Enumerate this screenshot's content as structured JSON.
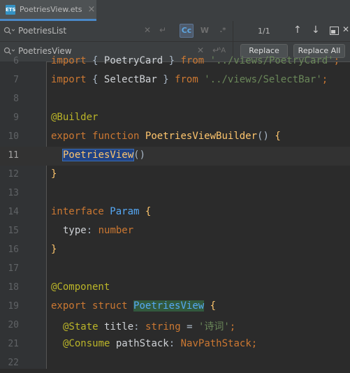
{
  "tab": {
    "file_name": "PoetriesView.ets",
    "icon_label": "ETS",
    "close": "×"
  },
  "find": {
    "query": "PoetriesList",
    "count": "1/1"
  },
  "replace": {
    "value": "PoetriesView",
    "replace_label": "Replace",
    "replace_all_label": "Replace All"
  },
  "find_options": {
    "case": "Cc",
    "words": "W",
    "regex": ".*"
  },
  "editor": {
    "lines": [
      {
        "n": "6"
      },
      {
        "n": "7"
      },
      {
        "n": "8"
      },
      {
        "n": "9"
      },
      {
        "n": "10"
      },
      {
        "n": "11"
      },
      {
        "n": "12"
      },
      {
        "n": "13"
      },
      {
        "n": "14"
      },
      {
        "n": "15"
      },
      {
        "n": "16"
      },
      {
        "n": "17"
      },
      {
        "n": "18"
      },
      {
        "n": "19"
      },
      {
        "n": "20"
      },
      {
        "n": "21"
      },
      {
        "n": "22"
      }
    ],
    "t": {
      "import": "import",
      "lb": "{",
      "rb": "}",
      "poetrycard": "PoetryCard",
      "from": "from",
      "path_card": "'../views/PoetryCard'",
      "semi": ";",
      "selectbar": "SelectBar",
      "path_select": "'../views/SelectBar'",
      "builder": "@Builder",
      "export": "export",
      "function": "function",
      "builder_fn": "PoetriesViewBuilder",
      "parens": "()",
      "open_brace": "{",
      "call_name": "PoetriesView",
      "close_brace": "}",
      "interface": "interface",
      "param": "Param",
      "type_key": "type",
      "colon": ":",
      "number": "number",
      "component": "@Component",
      "struct": "struct",
      "struct_name": "PoetriesView",
      "state": "@State",
      "title": "title",
      "string": "string",
      "eq": "=",
      "title_val": "'诗词'",
      "consume": "@Consume",
      "pathstack": "pathStack",
      "navpath": "NavPathStack"
    }
  }
}
